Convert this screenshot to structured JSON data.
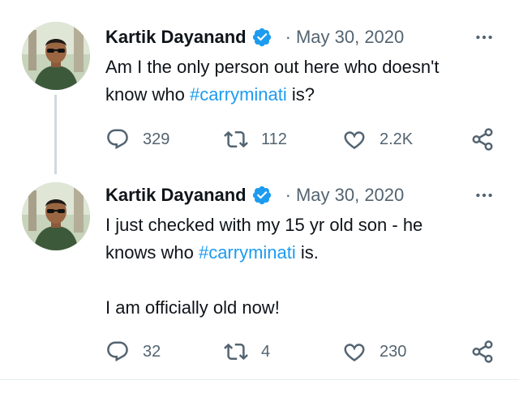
{
  "tweets": [
    {
      "author": "Kartik Dayanand",
      "separator": "·",
      "date": "May 30, 2020",
      "text_before": "Am I the only person out here who doesn't",
      "text_line2_before": "know who ",
      "hashtag": "#carryminati",
      "text_after": " is?",
      "replies": "329",
      "retweets": "112",
      "likes": "2.2K"
    },
    {
      "author": "Kartik Dayanand",
      "separator": "·",
      "date": "May 30, 2020",
      "text_line1": "I just checked with my 15 yr old son - he",
      "text_line2_before": "knows who ",
      "hashtag": "#carryminati",
      "text_after": " is.",
      "text_line3": "I am officially old now!",
      "replies": "32",
      "retweets": "4",
      "likes": "230"
    }
  ],
  "colors": {
    "hashtag": "#1d9bf0",
    "verified": "#1d9bf0",
    "muted": "#536471",
    "thread_line": "#cfd9de"
  },
  "icons": [
    "verified-badge-icon",
    "more-icon",
    "reply-icon",
    "retweet-icon",
    "like-icon",
    "share-icon"
  ]
}
